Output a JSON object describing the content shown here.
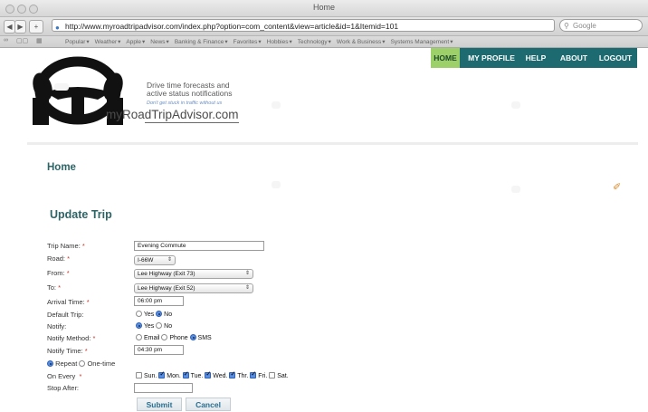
{
  "browser": {
    "window_title": "Home",
    "url": "http://www.myroadtripadvisor.com/index.php?option=com_content&view=article&id=1&Itemid=101",
    "search_placeholder": "Google",
    "back_glyph": "◀",
    "forward_glyph": "▶",
    "add_glyph": "+",
    "reload_glyph": "C",
    "bookmarks": [
      "Popular",
      "Weather",
      "Apple",
      "News",
      "Banking & Finance",
      "Favorites",
      "Hobbies",
      "Technology",
      "Work & Business",
      "Systems Management"
    ]
  },
  "nav": {
    "items": [
      "HOME",
      "MY PROFILE",
      "HELP",
      "ABOUT",
      "LOGOUT"
    ],
    "active": "HOME",
    "bar_color": "#1d6a70",
    "active_color": "#9ed06a"
  },
  "brand": {
    "tagline_1": "Drive time forecasts and",
    "tagline_2": "active status notifications",
    "subtag": "Don't get stuck in traffic without us",
    "site_name": "myRoadTripAdvisor.com"
  },
  "page": {
    "heading": "Home",
    "section_heading": "Update Trip",
    "pdf_icon": "pdf-icon"
  },
  "form": {
    "labels": {
      "trip_name": "Trip Name:",
      "road": "Road:",
      "from": "From:",
      "to": "To:",
      "arrival_time": "Arrival Time:",
      "default_trip": "Default Trip:",
      "notify": "Notify:",
      "notify_method": "Notify Method:",
      "notify_time": "Notify Time:",
      "on_every": "On Every",
      "stop_after": "Stop After:"
    },
    "required_mark": "*",
    "trip_name": "Evening Commute",
    "road": "I-66W",
    "from": "Lee Highway (Exit 73)",
    "to": "Lee Highway (Exit 52)",
    "arrival_time": "06:00 pm",
    "default_trip": {
      "yes": "Yes",
      "no": "No",
      "selected": "No"
    },
    "notify": {
      "yes": "Yes",
      "no": "No",
      "selected": "Yes"
    },
    "notify_method": {
      "email": "Email",
      "phone": "Phone",
      "sms": "SMS",
      "selected": "SMS"
    },
    "notify_time": "04:30 pm",
    "frequency": {
      "repeat": "Repeat",
      "onetime": "One-time",
      "selected": "Repeat"
    },
    "days": [
      {
        "label": "Sun.",
        "checked": false
      },
      {
        "label": "Mon.",
        "checked": true
      },
      {
        "label": "Tue.",
        "checked": true
      },
      {
        "label": "Wed.",
        "checked": true
      },
      {
        "label": "Thr.",
        "checked": true
      },
      {
        "label": "Fri.",
        "checked": true
      },
      {
        "label": "Sat.",
        "checked": false
      }
    ],
    "stop_after": "",
    "submit_label": "Submit",
    "cancel_label": "Cancel"
  }
}
